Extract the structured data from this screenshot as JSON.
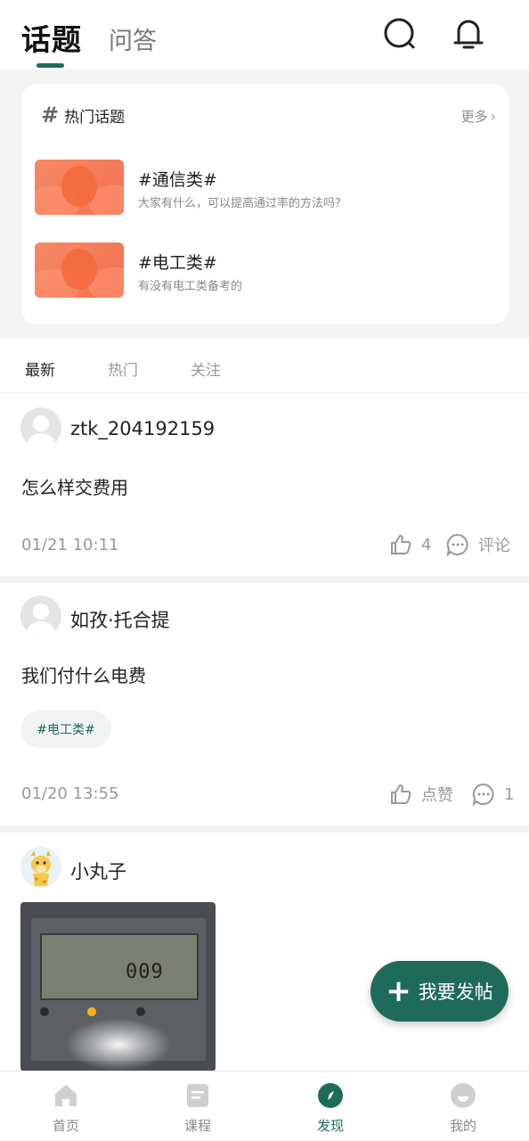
{
  "header": {
    "tabs": [
      {
        "label": "话题",
        "active": true
      },
      {
        "label": "问答",
        "active": false
      }
    ],
    "icons": [
      "search-icon",
      "bell-icon"
    ]
  },
  "hot_topics": {
    "title": "热门话题",
    "more_label": "更多",
    "items": [
      {
        "name": "#通信类#",
        "desc": "大家有什么，可以提高通过率的方法吗?"
      },
      {
        "name": "#电工类#",
        "desc": "有没有电工类备考的"
      }
    ]
  },
  "filter_tabs": [
    {
      "label": "最新",
      "active": true
    },
    {
      "label": "热门",
      "active": false
    },
    {
      "label": "关注",
      "active": false
    }
  ],
  "posts": [
    {
      "username": "ztk_204192159",
      "content": "怎么样交费用",
      "time": "01/21 10:11",
      "like_label": "4",
      "comment_label": "评论"
    },
    {
      "username": "如孜·托合提",
      "content": "我们付什么电费",
      "tag": "#电工类#",
      "time": "01/20 13:55",
      "like_label": "点赞",
      "comment_label": "1"
    },
    {
      "username": "小丸子",
      "photo_digits": "009"
    }
  ],
  "fab": {
    "label": "我要发帖"
  },
  "bottom_nav": [
    {
      "label": "首页",
      "active": false
    },
    {
      "label": "课程",
      "active": false
    },
    {
      "label": "发现",
      "active": true
    },
    {
      "label": "我的",
      "active": false
    }
  ],
  "colors": {
    "accent": "#1e6b5c",
    "thumb": "#f47c57",
    "muted": "#999999"
  }
}
